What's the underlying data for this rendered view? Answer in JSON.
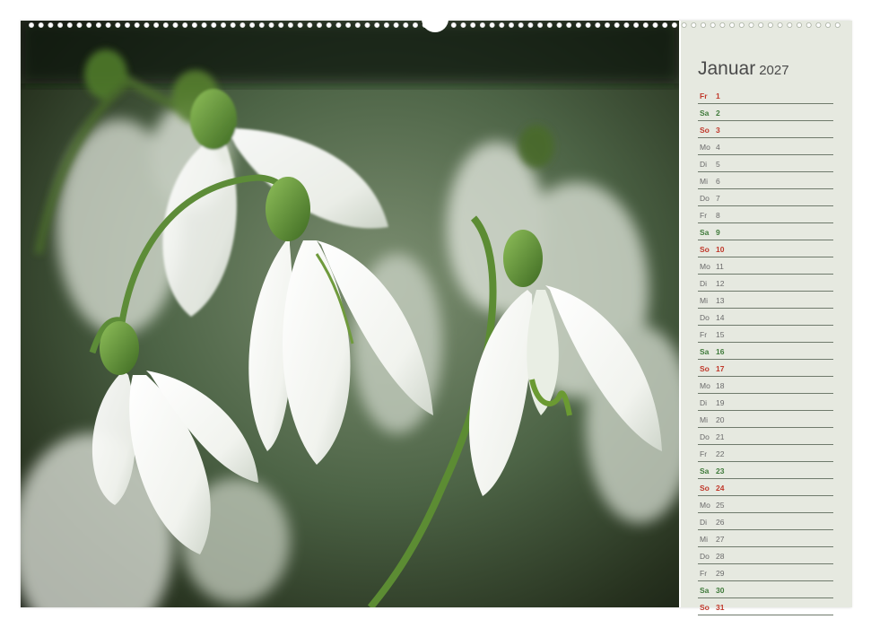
{
  "calendar": {
    "month": "Januar",
    "year": "2027",
    "days": [
      {
        "wd": "Fr",
        "d": "1",
        "type": "holiday"
      },
      {
        "wd": "Sa",
        "d": "2",
        "type": "sat"
      },
      {
        "wd": "So",
        "d": "3",
        "type": "sun"
      },
      {
        "wd": "Mo",
        "d": "4",
        "type": "weekday"
      },
      {
        "wd": "Di",
        "d": "5",
        "type": "weekday"
      },
      {
        "wd": "Mi",
        "d": "6",
        "type": "weekday"
      },
      {
        "wd": "Do",
        "d": "7",
        "type": "weekday"
      },
      {
        "wd": "Fr",
        "d": "8",
        "type": "weekday"
      },
      {
        "wd": "Sa",
        "d": "9",
        "type": "sat"
      },
      {
        "wd": "So",
        "d": "10",
        "type": "sun"
      },
      {
        "wd": "Mo",
        "d": "11",
        "type": "weekday"
      },
      {
        "wd": "Di",
        "d": "12",
        "type": "weekday"
      },
      {
        "wd": "Mi",
        "d": "13",
        "type": "weekday"
      },
      {
        "wd": "Do",
        "d": "14",
        "type": "weekday"
      },
      {
        "wd": "Fr",
        "d": "15",
        "type": "weekday"
      },
      {
        "wd": "Sa",
        "d": "16",
        "type": "sat"
      },
      {
        "wd": "So",
        "d": "17",
        "type": "sun"
      },
      {
        "wd": "Mo",
        "d": "18",
        "type": "weekday"
      },
      {
        "wd": "Di",
        "d": "19",
        "type": "weekday"
      },
      {
        "wd": "Mi",
        "d": "20",
        "type": "weekday"
      },
      {
        "wd": "Do",
        "d": "21",
        "type": "weekday"
      },
      {
        "wd": "Fr",
        "d": "22",
        "type": "weekday"
      },
      {
        "wd": "Sa",
        "d": "23",
        "type": "sat"
      },
      {
        "wd": "So",
        "d": "24",
        "type": "sun"
      },
      {
        "wd": "Mo",
        "d": "25",
        "type": "weekday"
      },
      {
        "wd": "Di",
        "d": "26",
        "type": "weekday"
      },
      {
        "wd": "Mi",
        "d": "27",
        "type": "weekday"
      },
      {
        "wd": "Do",
        "d": "28",
        "type": "weekday"
      },
      {
        "wd": "Fr",
        "d": "29",
        "type": "weekday"
      },
      {
        "wd": "Sa",
        "d": "30",
        "type": "sat"
      },
      {
        "wd": "So",
        "d": "31",
        "type": "sun"
      }
    ]
  },
  "photo": {
    "subject": "snowdrop-flowers-icon"
  },
  "colors": {
    "weekday": "#6a6a6a",
    "saturday": "#3f7a3a",
    "sunday": "#c0392b",
    "sidebar": "#e6e9e0"
  }
}
